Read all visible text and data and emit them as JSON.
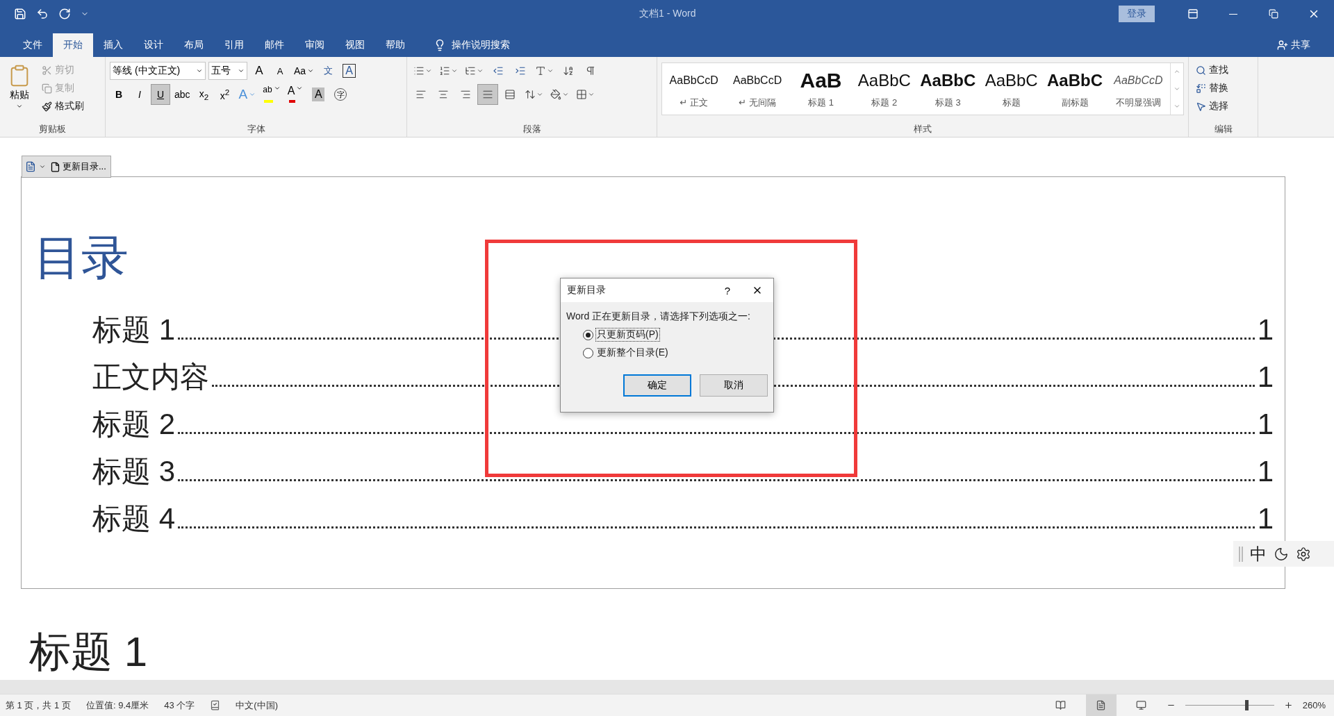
{
  "window": {
    "title": "文档1 - Word",
    "login": "登录"
  },
  "ribbon_tabs": [
    {
      "label": "文件",
      "selected": false
    },
    {
      "label": "开始",
      "selected": true
    },
    {
      "label": "插入",
      "selected": false
    },
    {
      "label": "设计",
      "selected": false
    },
    {
      "label": "布局",
      "selected": false
    },
    {
      "label": "引用",
      "selected": false
    },
    {
      "label": "邮件",
      "selected": false
    },
    {
      "label": "审阅",
      "selected": false
    },
    {
      "label": "视图",
      "selected": false
    },
    {
      "label": "帮助",
      "selected": false
    }
  ],
  "tell_me": "操作说明搜索",
  "share": "共享",
  "clipboard": {
    "paste": "粘贴",
    "items": [
      {
        "kind": "cut",
        "label": "剪切",
        "disabled": true
      },
      {
        "kind": "copy",
        "label": "复制",
        "disabled": true
      },
      {
        "kind": "painter",
        "label": "格式刷",
        "disabled": false
      }
    ],
    "group": "剪贴板"
  },
  "font": {
    "name": "等线 (中文正文)",
    "size": "五号",
    "group": "字体",
    "top_glyphs": [
      {
        "kind": "grow",
        "label": "A"
      },
      {
        "kind": "shrink",
        "label": "A"
      },
      {
        "kind": "case",
        "label": "Aa"
      },
      {
        "kind": "phonetic",
        "label": "文"
      },
      {
        "kind": "border",
        "label": "A"
      }
    ],
    "format_buttons": [
      {
        "label": "B",
        "selected": false
      },
      {
        "label": "I",
        "selected": false
      },
      {
        "label": "U",
        "selected": true
      },
      {
        "label": "abc",
        "selected": false
      },
      {
        "label": "x$_{2}$",
        "selected": false
      },
      {
        "label": "x$^{2}$",
        "selected": false
      }
    ],
    "bottom_glyphs": [
      {
        "kind": "effects",
        "label": "A"
      },
      {
        "kind": "highlight",
        "label": "ab"
      },
      {
        "kind": "color",
        "label": "A"
      },
      {
        "kind": "shading",
        "label": "A"
      },
      {
        "kind": "enclose",
        "label": "字"
      }
    ]
  },
  "paragraph": {
    "group": "段落",
    "alignment": [
      {
        "kind": "left",
        "selected": false
      },
      {
        "kind": "center",
        "selected": false
      },
      {
        "kind": "right",
        "selected": false
      },
      {
        "kind": "justify",
        "selected": true
      },
      {
        "kind": "distribute",
        "selected": false
      }
    ]
  },
  "styles": {
    "group": "样式",
    "items": [
      {
        "kind": "normal",
        "preview": "AaBbCcD",
        "prefix": "↵",
        "name": "正文"
      },
      {
        "kind": "normal",
        "preview": "AaBbCcD",
        "prefix": "↵",
        "name": "无间隔"
      },
      {
        "kind": "h1",
        "preview": "AaB",
        "name": "标题 1"
      },
      {
        "kind": "h2",
        "preview": "AaBbC",
        "name": "标题 2"
      },
      {
        "kind": "h3",
        "preview": "AaBbC",
        "name": "标题 3"
      },
      {
        "kind": "title",
        "preview": "AaBbC",
        "name": "标题"
      },
      {
        "kind": "h3",
        "preview": "AaBbC",
        "name": "副标题"
      },
      {
        "kind": "emphasis",
        "preview": "AaBbCcD",
        "name": "不明显强调"
      }
    ]
  },
  "editing": {
    "group": "编辑",
    "items": [
      {
        "kind": "find",
        "label": "查找"
      },
      {
        "kind": "replace",
        "label": "替换"
      },
      {
        "kind": "select",
        "label": "选择"
      }
    ]
  },
  "toc_toolbar": {
    "update": "更新目录..."
  },
  "toc": {
    "title": "目录",
    "entries": [
      {
        "text": "标题 1",
        "page": "1"
      },
      {
        "text": "正文内容",
        "page": "1"
      },
      {
        "text": "标题 2",
        "page": "1"
      },
      {
        "text": "标题 3",
        "page": "1"
      },
      {
        "text": "标题 4",
        "page": "1"
      }
    ]
  },
  "body_heading": "标题 1",
  "dialog": {
    "title": "更新目录",
    "help": "?",
    "message": "Word 正在更新目录，请选择下列选项之一:",
    "options": [
      {
        "label": "只更新页码(P)",
        "selected": true
      },
      {
        "label": "更新整个目录(E)",
        "selected": false
      }
    ],
    "buttons": [
      {
        "label": "确定",
        "default": true
      },
      {
        "label": "取消",
        "default": false
      }
    ]
  },
  "ime": {
    "mode": "中"
  },
  "status_bar": {
    "items": [
      "第 1 页，共 1 页",
      "位置值: 9.4厘米",
      "43 个字"
    ],
    "language": "中文(中国)",
    "zoom": {
      "level": 0.69,
      "reading": "260%"
    }
  }
}
